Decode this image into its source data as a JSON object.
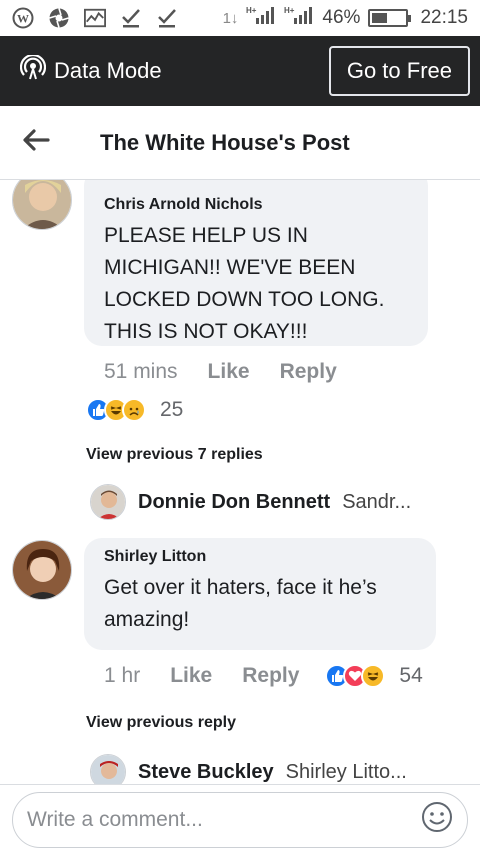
{
  "status_bar": {
    "icons": [
      "wordpress-icon",
      "aperture-icon",
      "activity-icon",
      "check-icon",
      "check-icon"
    ],
    "network_labels": [
      "1↓",
      "H+",
      "H+"
    ],
    "battery": "46%",
    "battery_level": 0.46,
    "time": "22:15"
  },
  "data_bar": {
    "mode_label": "Data Mode",
    "go_free_label": "Go to Free"
  },
  "header": {
    "title": "The White House's Post"
  },
  "comments": [
    {
      "author": "Chris Arnold Nichols",
      "text": "PLEASE HELP US IN MICHIGAN!!  WE'VE BEEN LOCKED DOWN TOO LONG. THIS IS NOT OKAY!!!",
      "time": "51 mins",
      "like": "Like",
      "reply": "Reply",
      "reactions": [
        "like",
        "haha",
        "sad"
      ],
      "reaction_count": "25",
      "view_previous": "View previous 7 replies",
      "last_reply": {
        "author": "Donnie Don Bennett",
        "preview": "Sandr..."
      }
    },
    {
      "author": "Shirley Litton",
      "text": "Get over it haters, face it he’s amazing!",
      "time": "1 hr",
      "like": "Like",
      "reply": "Reply",
      "reactions": [
        "like",
        "love",
        "haha"
      ],
      "reaction_count": "54",
      "view_previous": "View previous reply",
      "last_reply": {
        "author": "Steve Buckley",
        "preview": "Shirley Litto..."
      }
    }
  ],
  "composer": {
    "placeholder": "Write a comment..."
  },
  "colors": {
    "databar_bg": "#242526",
    "bubble_bg": "#f0f2f5",
    "meta_text": "#8a8d91",
    "like_blue": "#1877f2",
    "love_red": "#f33e58",
    "haha_yellow": "#f7b928"
  }
}
